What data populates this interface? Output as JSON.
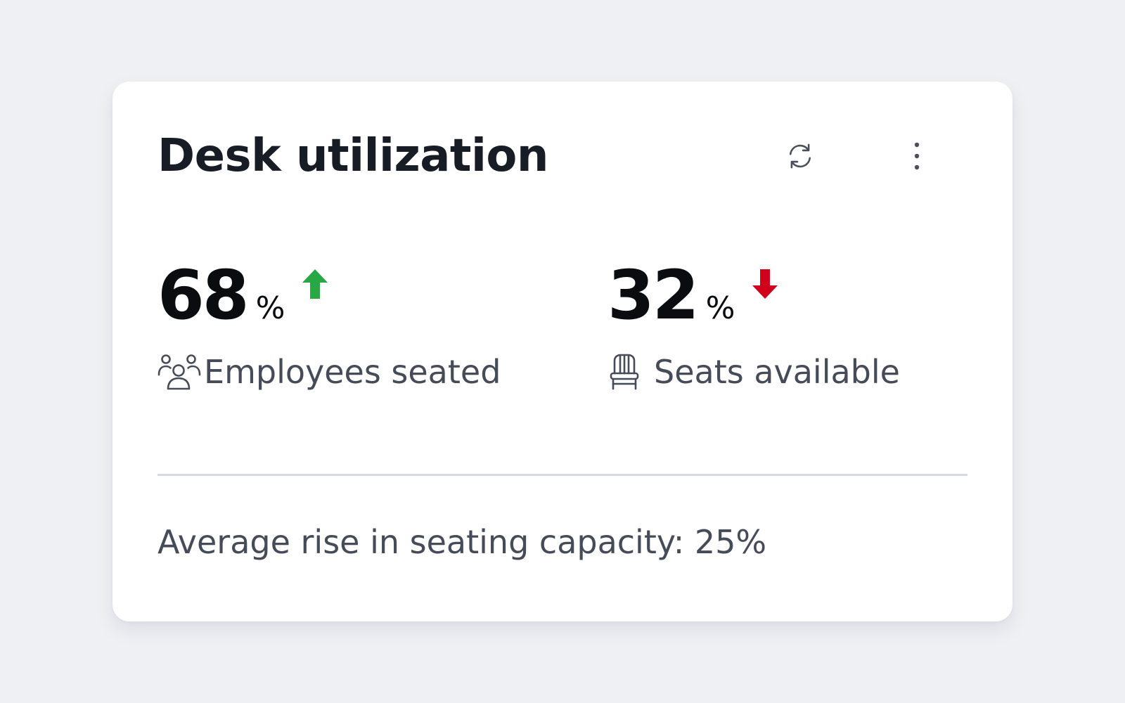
{
  "card": {
    "title": "Desk utilization",
    "actions": [
      {
        "name": "refresh",
        "icon": "refresh-icon"
      },
      {
        "name": "more",
        "icon": "more-vertical-icon"
      }
    ]
  },
  "metrics": [
    {
      "value": "68",
      "unit": "%",
      "trend": "up",
      "trend_icon": "arrow-up-icon",
      "trend_color": "#28a745",
      "label": "Employees seated",
      "icon": "people-group-icon"
    },
    {
      "value": "32",
      "unit": "%",
      "trend": "down",
      "trend_icon": "arrow-down-icon",
      "trend_color": "#d0021b",
      "label": "Seats available",
      "icon": "chair-icon"
    }
  ],
  "footer": {
    "text": "Average rise in seating capacity: 25%"
  },
  "colors": {
    "background": "#eef0f4",
    "card": "#ffffff",
    "title": "#181c24",
    "secondary_text": "#464b58",
    "divider": "#d7d9de"
  }
}
